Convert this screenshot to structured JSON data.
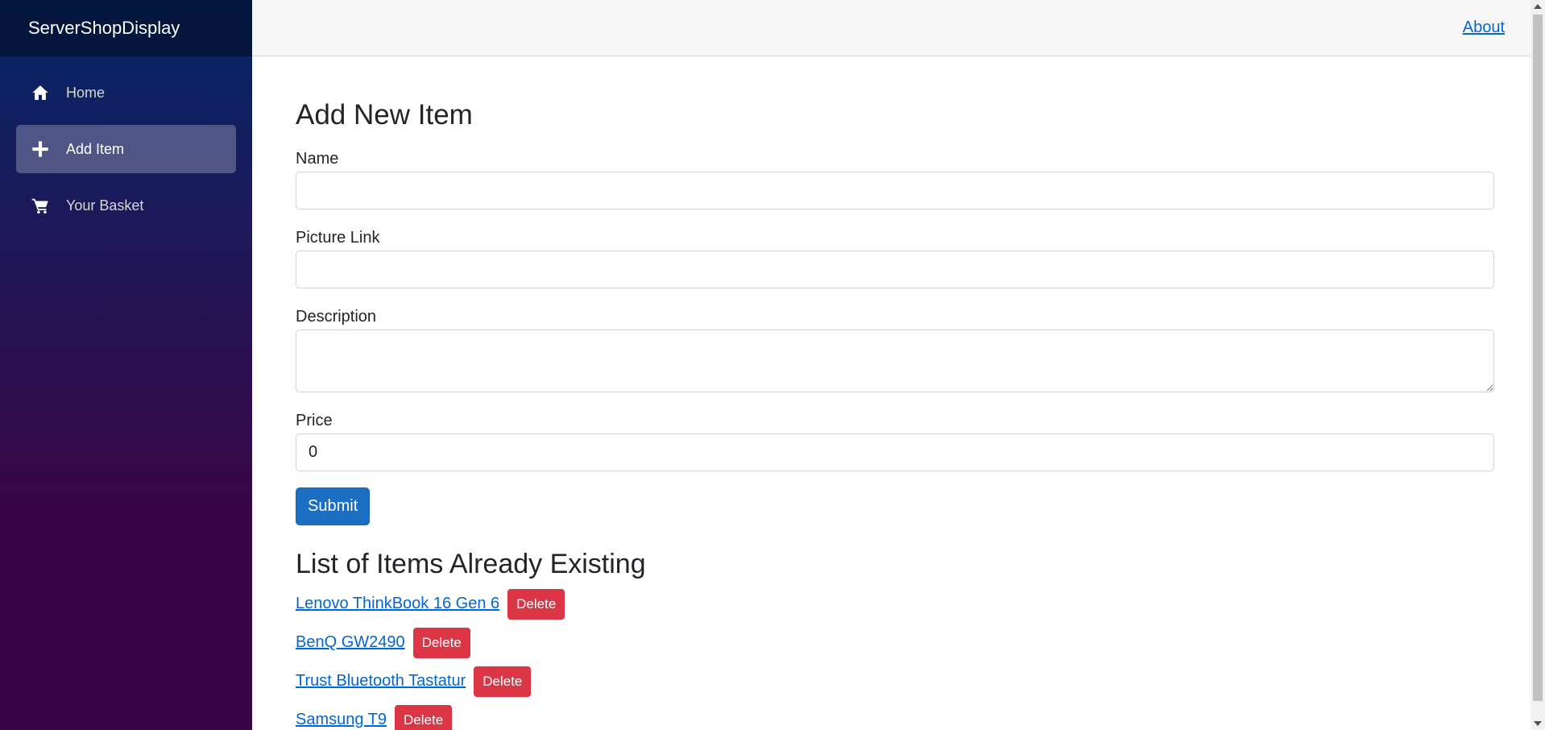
{
  "sidebar": {
    "brand": "ServerShopDisplay",
    "items": [
      {
        "label": "Home",
        "icon": "home-icon",
        "active": false
      },
      {
        "label": "Add Item",
        "icon": "plus-icon",
        "active": true
      },
      {
        "label": "Your Basket",
        "icon": "cart-icon",
        "active": false
      }
    ]
  },
  "top_row": {
    "about_label": "About"
  },
  "form": {
    "title": "Add New Item",
    "name_label": "Name",
    "name_value": "",
    "picture_label": "Picture Link",
    "picture_value": "",
    "description_label": "Description",
    "description_value": "",
    "price_label": "Price",
    "price_value": "0",
    "submit_label": "Submit"
  },
  "items_list": {
    "title": "List of Items Already Existing",
    "delete_label": "Delete",
    "items": [
      "Lenovo ThinkBook 16 Gen 6",
      "BenQ GW2490",
      "Trust Bluetooth Tastatur",
      "Samsung T9"
    ]
  },
  "colors": {
    "sidebar_top": "#052767",
    "sidebar_bottom": "#3a0647",
    "primary": "#1b6ec2",
    "danger": "#dc3545",
    "link": "#0366d6"
  }
}
